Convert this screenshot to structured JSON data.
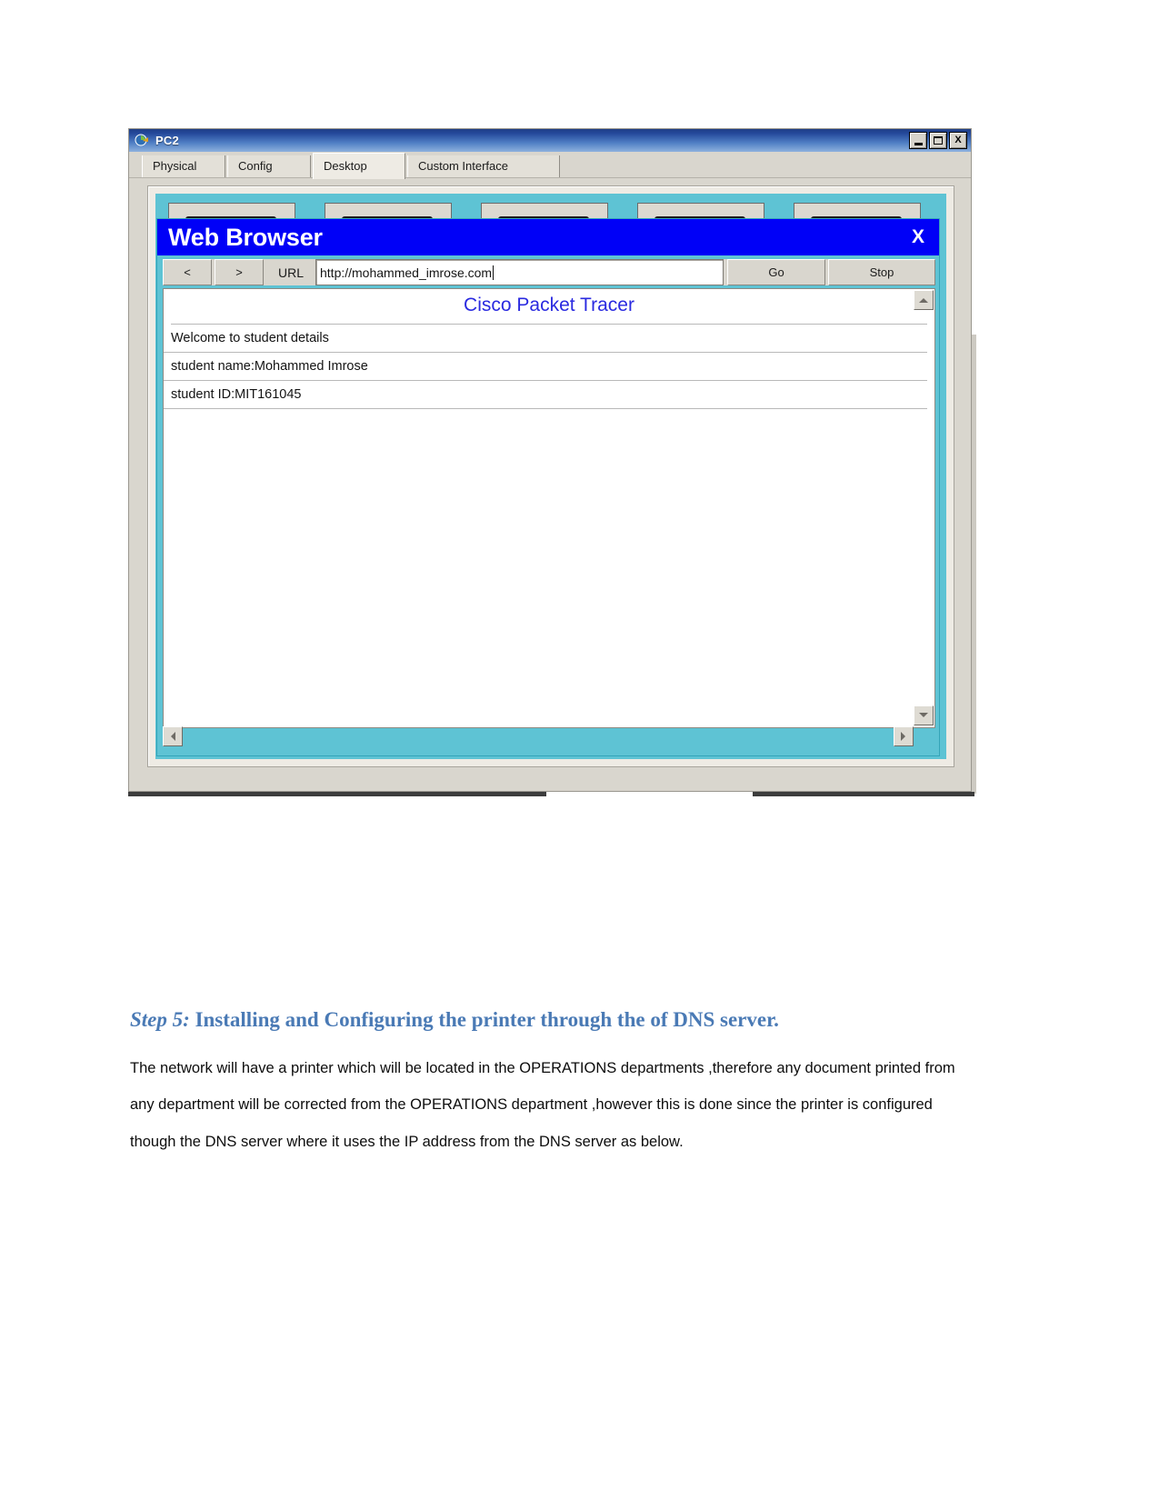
{
  "pc2_window": {
    "title": "PC2",
    "icon": "packet-tracer-icon",
    "buttons": {
      "minimize": "_",
      "maximize": "□",
      "close": "X"
    },
    "tabs": [
      {
        "label": "Physical",
        "active": false
      },
      {
        "label": "Config",
        "active": false
      },
      {
        "label": "Desktop",
        "active": true
      },
      {
        "label": "Custom Interface",
        "active": false
      }
    ]
  },
  "web_browser": {
    "title": "Web Browser",
    "close_label": "X",
    "toolbar": {
      "back_label": "<",
      "forward_label": ">",
      "url_label": "URL",
      "url_value": "http://mohammed_imrose.com",
      "url_placeholder": "http://",
      "go_label": "Go",
      "stop_label": "Stop"
    },
    "page": {
      "heading": "Cisco Packet Tracer",
      "lines": [
        "Welcome to student details",
        "student name:Mohammed Imrose",
        "student ID:MIT161045"
      ]
    },
    "scrollbars": {
      "up": "scroll-up-icon",
      "down": "scroll-down-icon",
      "left": "scroll-left-icon",
      "right": "scroll-right-icon"
    }
  },
  "document": {
    "heading_step": "Step 5:",
    "heading_rest": " Installing and Configuring the printer through the  of  DNS server.",
    "paragraph": "The network  will have a printer which will be located in the OPERATIONS departments ,therefore any document printed from any department will be corrected from the OPERATIONS department ,however this is done since the printer is configured though the DNS server where it uses the IP address from the DNS server as below."
  },
  "colors": {
    "titlebar_blue": "#24489a",
    "browser_blue": "#0000f7",
    "desktop_cyan": "#5ec3d4",
    "heading_blue": "#4a7ab5",
    "link_blue": "#2a2ae0"
  }
}
